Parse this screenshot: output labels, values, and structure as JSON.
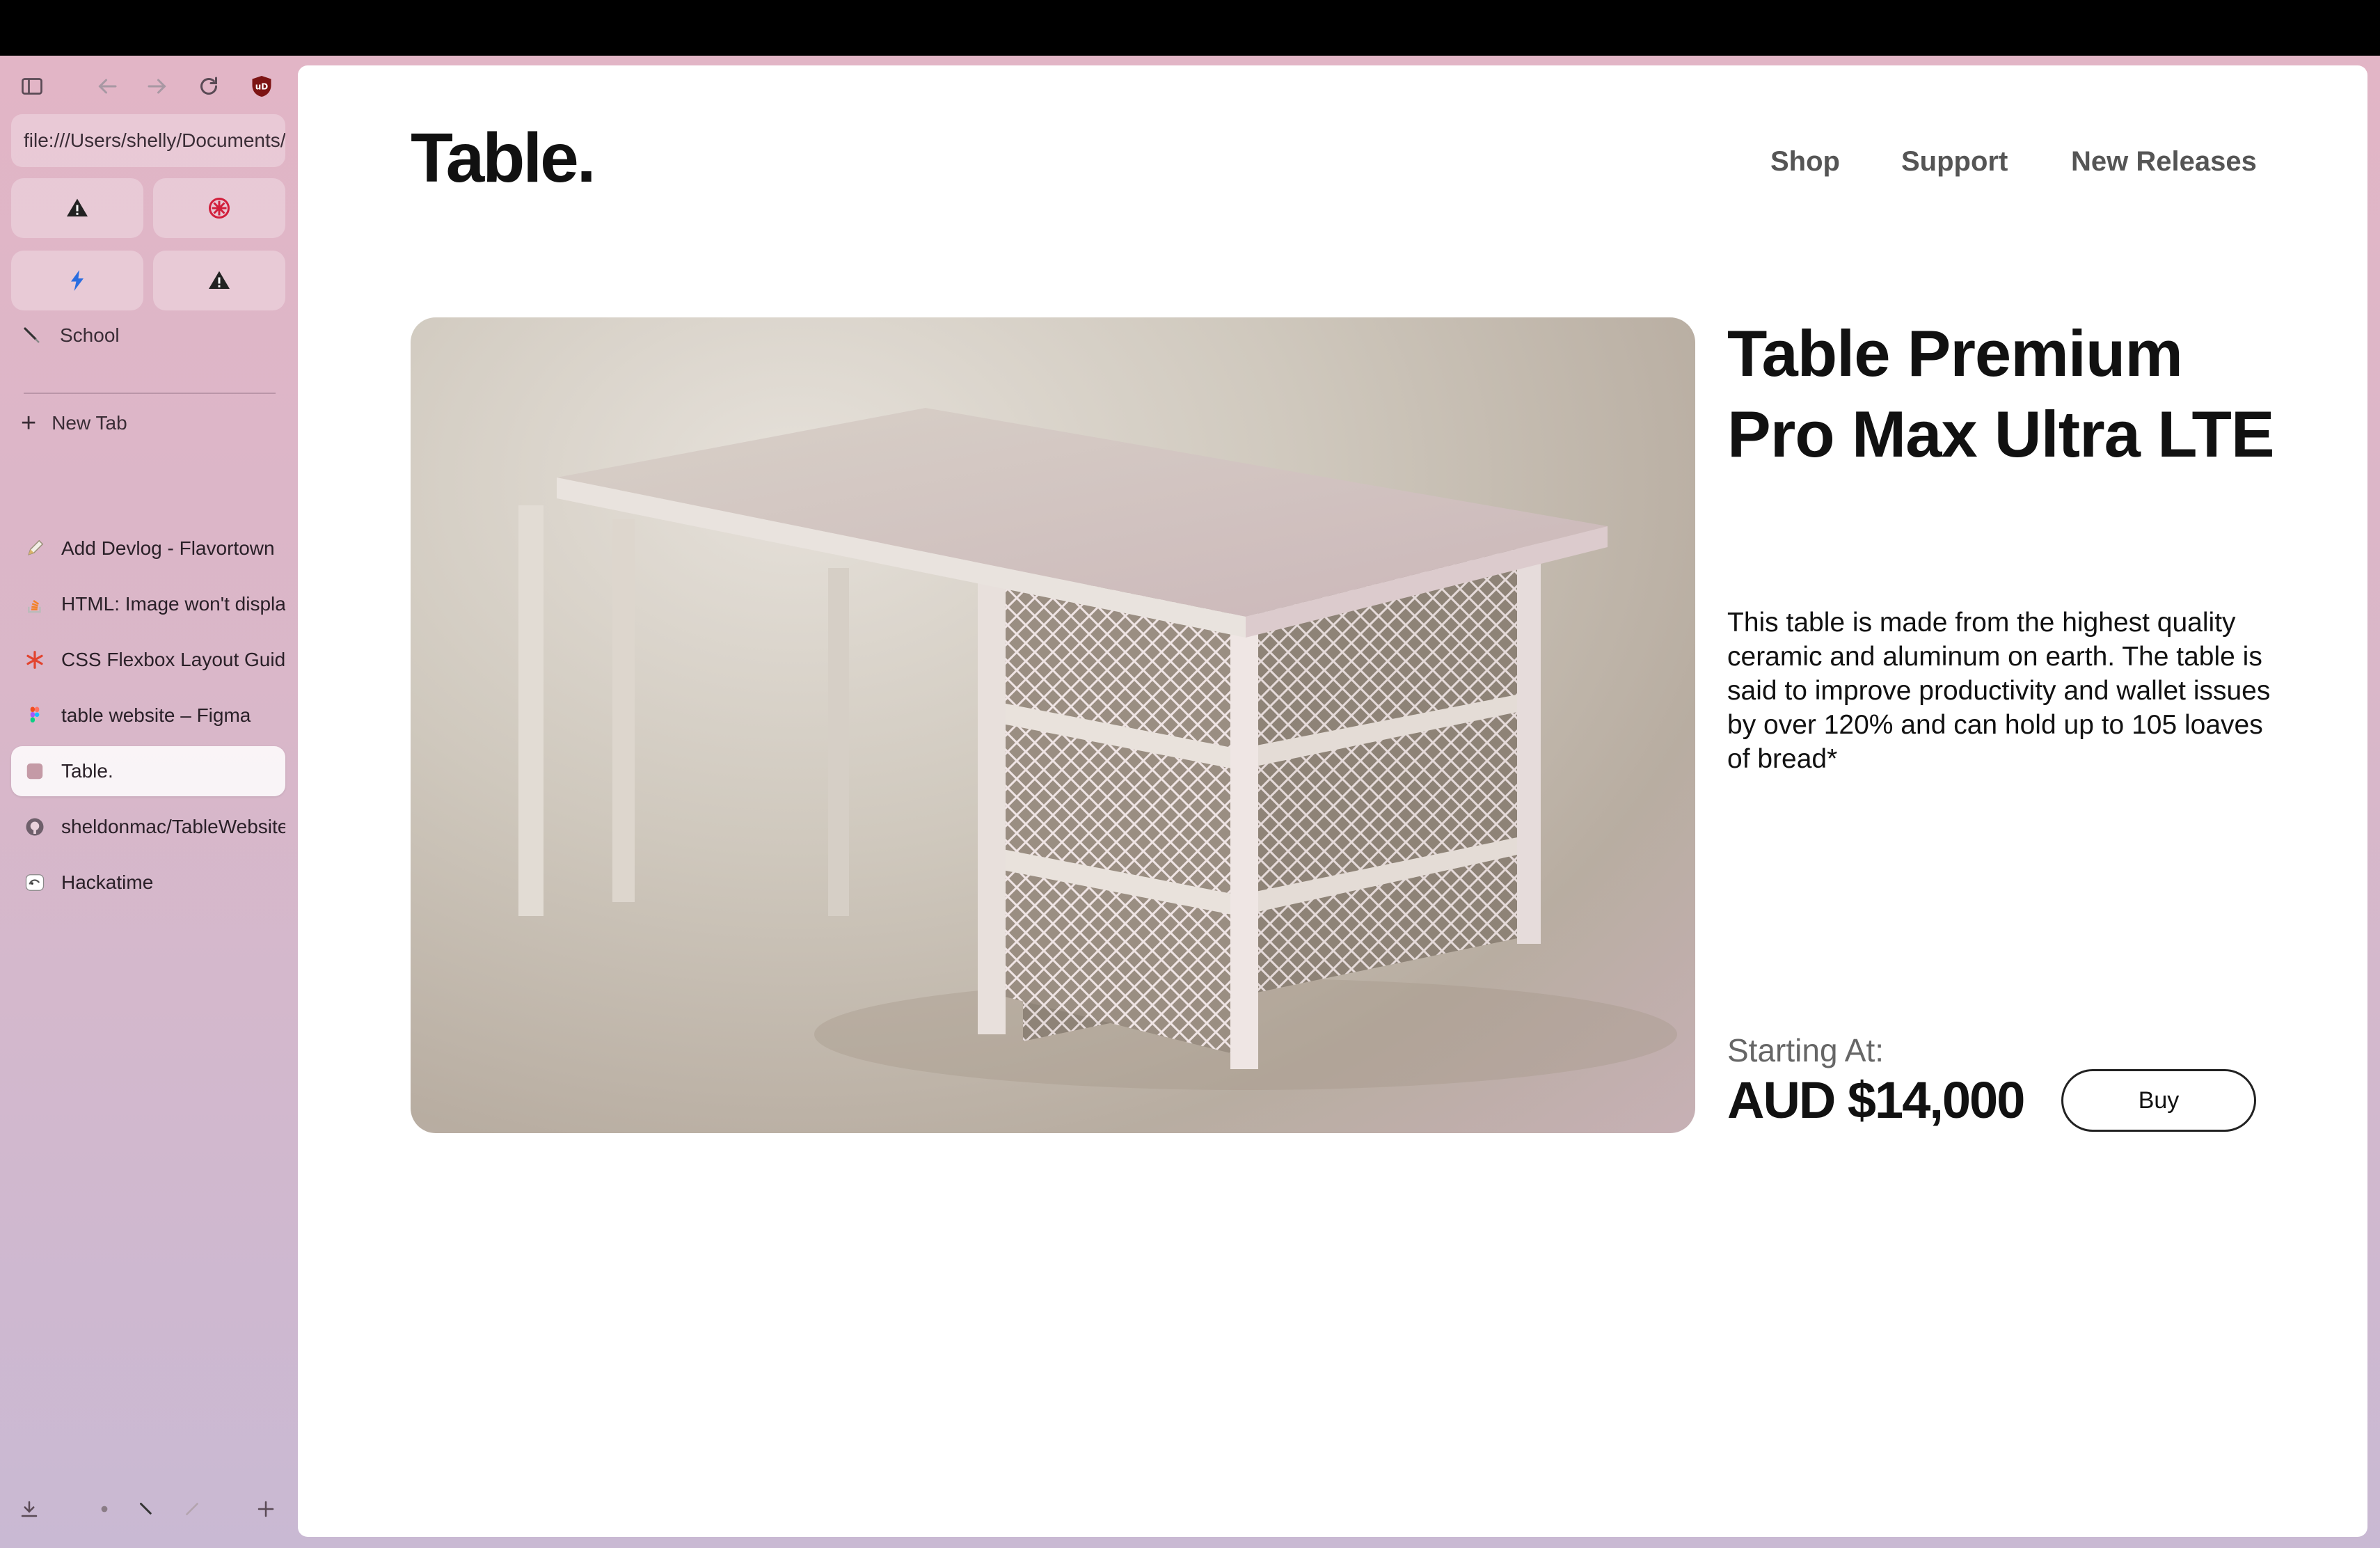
{
  "browser": {
    "address_bar": "file:///Users/shelly/Documents/TableWebsite/index.html",
    "pinned": [
      {
        "icon": "warning-icon"
      },
      {
        "icon": "red-asterisk-icon"
      },
      {
        "icon": "bolt-icon"
      },
      {
        "icon": "warning-icon"
      }
    ],
    "folder": {
      "label": "School",
      "icon": "pen-nib-icon"
    },
    "new_tab_label": "New Tab",
    "tabs": [
      {
        "label": "Add Devlog - Flavortown",
        "icon": "pen-icon",
        "active": false
      },
      {
        "label": "HTML: Image won't display",
        "icon": "stack-overflow-icon",
        "active": false
      },
      {
        "label": "CSS Flexbox Layout Guide",
        "icon": "asterisk-icon",
        "active": false
      },
      {
        "label": "table website – Figma",
        "icon": "figma-icon",
        "active": false
      },
      {
        "label": "Table.",
        "icon": "pink-square-icon",
        "active": true
      },
      {
        "label": "sheldonmac/TableWebsite",
        "icon": "github-icon",
        "active": false
      },
      {
        "label": "Hackatime",
        "icon": "hackatime-icon",
        "active": false
      }
    ]
  },
  "site": {
    "logo": "Table.",
    "nav": [
      "Shop",
      "Support",
      "New Releases"
    ],
    "product": {
      "title": "Table Premium Pro Max Ultra LTE",
      "description": "This table is made from the highest quality ceramic and aluminum on earth. The table is said to improve productivity and wallet issues by over 120% and can hold up to 105 loaves of bread*",
      "starting_label": "Starting At:",
      "price": "AUD $14,000",
      "buy_label": "Buy"
    }
  }
}
